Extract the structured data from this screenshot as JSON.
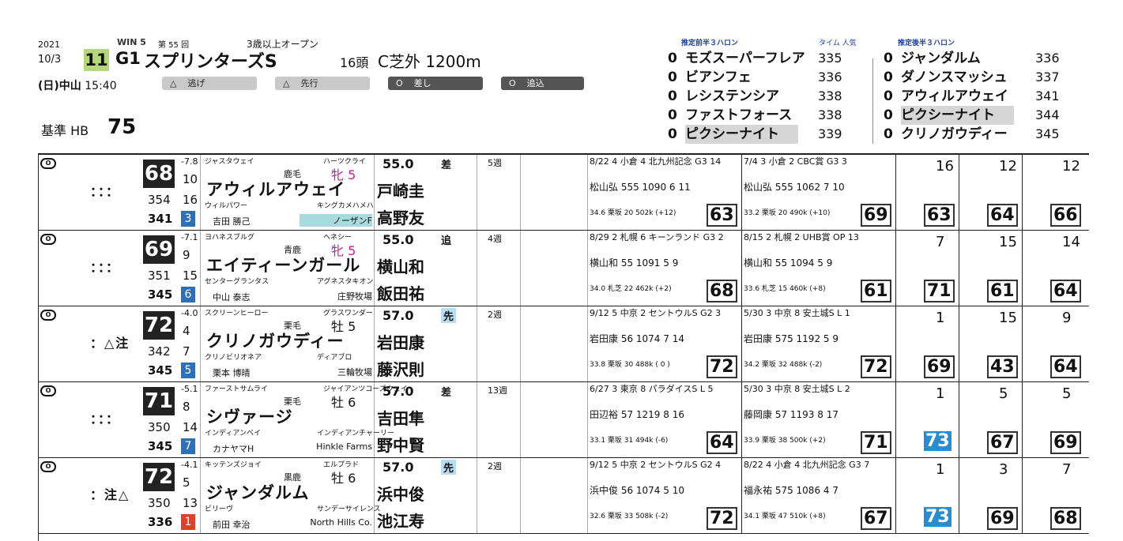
{
  "header": {
    "year": "2021",
    "date": "10/3",
    "day": "(日)",
    "venue": "中山",
    "time": "15:40",
    "win5": "WIN 5",
    "edition": "第 55 回",
    "race_no": "11",
    "grade": "G1",
    "race_name": "スプリンターズS",
    "condition": "3歳以上オープン",
    "field": "16頭",
    "course": "C芝外 1200m",
    "base_label": "基準 HB",
    "base_value": "75"
  },
  "styles": [
    {
      "mark": "△",
      "label": "逃げ"
    },
    {
      "mark": "△",
      "label": "先行"
    },
    {
      "mark": "O",
      "label": "差し"
    },
    {
      "mark": "O",
      "label": "追込"
    }
  ],
  "front_title": "推定前半３ハロン",
  "front_cols": "タイム 人気",
  "rear_title": "推定後半３ハロン",
  "front": [
    {
      "n": "0",
      "name": "モズスーパーフレア",
      "v": "335"
    },
    {
      "n": "0",
      "name": "ビアンフェ",
      "v": "336"
    },
    {
      "n": "0",
      "name": "レシステンシア",
      "v": "338"
    },
    {
      "n": "0",
      "name": "ファストフォース",
      "v": "338"
    },
    {
      "n": "0",
      "name": "ピクシーナイト",
      "v": "339"
    }
  ],
  "rear": [
    {
      "n": "0",
      "name": "ジャンダルム",
      "v": "336"
    },
    {
      "n": "0",
      "name": "ダノンスマッシュ",
      "v": "337"
    },
    {
      "n": "0",
      "name": "アウィルアウェイ",
      "v": "341"
    },
    {
      "n": "0",
      "name": "ピクシーナイト",
      "v": "344"
    },
    {
      "n": "0",
      "name": "クリノガウディー",
      "v": "345"
    }
  ],
  "horses": [
    {
      "mark": "O",
      "pred": "：：：",
      "idx": "68",
      "i1": "-7.8",
      "i2": "10",
      "i3": "354",
      "i4": "16",
      "i5": "341",
      "i6": "3",
      "sire": "ジャスタウェイ",
      "damsire": "ハーツクライ",
      "color": "鹿毛",
      "sex": "牝 5",
      "name": "アウィルアウェイ",
      "dam": "ウィルパワー",
      "damdam": "キングカメハメハ",
      "trainer": "吉田 勝己",
      "farm": "ノーザンF",
      "weight": "55.0",
      "style": "差",
      "wk": "5週",
      "jockey1": "戸崎圭",
      "jockey2": "高野友",
      "r1": "8/22 4 小倉 4 北九州記念 G3 14",
      "r1b": "松山弘 555 1090 6 11",
      "r1c": "34.6 栗坂 20 502k (+12)",
      "r1s": "63",
      "r2": "7/4 3 小倉 2 CBC賞 G3 3",
      "r2b": "松山弘 555 1062 7 10",
      "r2c": "33.2 栗坂 20 490k (+10)",
      "r2s": "69",
      "h1": "16",
      "h1s": "63",
      "h2": "12",
      "h2s": "64",
      "h3": "12",
      "h3s": "66"
    },
    {
      "mark": "O",
      "pred": "：：：",
      "idx": "69",
      "i1": "-7.1",
      "i2": "9",
      "i3": "351",
      "i4": "15",
      "i5": "345",
      "i6": "6",
      "sire": "ヨハネスブルグ",
      "damsire": "ヘネシー",
      "color": "青鹿",
      "sex": "牝 5",
      "name": "エイティーンガール",
      "dam": "センターグランタス",
      "damdam": "アグネスタキオン",
      "trainer": "中山 泰志",
      "farm": "庄野牧場",
      "weight": "55.0",
      "style": "追",
      "wk": "4週",
      "jockey1": "横山和",
      "jockey2": "飯田祐",
      "r1": "8/29 2 札幌 6 キーンランド G3 2",
      "r1b": "横山和 55 1091 5 9",
      "r1c": "34.0 札芝 22 462k (+2)",
      "r1s": "68",
      "r2": "8/15 2 札幌 2 UHB賞 OP 13",
      "r2b": "横山和 55 1094 5 9",
      "r2c": "33.6 札芝 15 460k (+8)",
      "r2s": "61",
      "h1": "7",
      "h1s": "71",
      "h2": "15",
      "h2s": "61",
      "h3": "14",
      "h3s": "64"
    },
    {
      "mark": "O",
      "pred": "：△注",
      "idx": "72",
      "i1": "-4.0",
      "i2": "4",
      "i3": "342",
      "i4": "7",
      "i5": "345",
      "i6": "5",
      "sire": "スクリーンヒーロー",
      "damsire": "グラスワンダー",
      "color": "栗毛",
      "sex": "牡 5",
      "name": "クリノガウディー",
      "dam": "クリノビリオネア",
      "damdam": "ディアブロ",
      "trainer": "栗本 博晴",
      "farm": "三輪牧場",
      "weight": "57.0",
      "style": "先",
      "wk": "2週",
      "jockey1": "岩田康",
      "jockey2": "藤沢則",
      "r1": "9/12 5 中京 2 セントウルS G2 3",
      "r1b": "岩田康 56 1074 7 14",
      "r1c": "33.8 栗坂 30 488k ( 0 )",
      "r1s": "72",
      "r2": "5/30 3 中京 8 安土城S L 1",
      "r2b": "岩田康 575 1192 5 9",
      "r2c": "34.2 栗坂 32 488k (-2)",
      "r2s": "72",
      "h1": "1",
      "h1s": "69",
      "h2": "15",
      "h2s": "43",
      "h3": "9",
      "h3s": "64"
    },
    {
      "mark": "O",
      "pred": "：：：",
      "idx": "71",
      "i1": "-5.1",
      "i2": "8",
      "i3": "350",
      "i4": "14",
      "i5": "345",
      "i6": "7",
      "sire": "ファーストサムライ",
      "damsire": "ジャイアンツコーズウェイ",
      "color": "栗毛",
      "sex": "牡 6",
      "name": "シヴァージ",
      "dam": "インディアンベイ",
      "damdam": "インディアンチャーリー",
      "trainer": "カナヤマH",
      "farm": "Hinkle Farms",
      "weight": "57.0",
      "style": "差",
      "wk": "13週",
      "jockey1": "吉田隼",
      "jockey2": "野中賢",
      "r1": "6/27 3 東京 8 パラダイスS L 5",
      "r1b": "田辺裕 57 1219 8 16",
      "r1c": "33.1 栗坂 31 494k (-6)",
      "r1s": "64",
      "r2": "5/30 3 中京 8 安土城S L 2",
      "r2b": "藤岡康 57 1193 8 17",
      "r2c": "33.9 栗坂 38 500k (+2)",
      "r2s": "71",
      "h1": "1",
      "h1s": "73",
      "h2": "5",
      "h2s": "67",
      "h3": "5",
      "h3s": "69"
    },
    {
      "mark": "O",
      "pred": "：注△",
      "idx": "72",
      "i1": "-4.1",
      "i2": "5",
      "i3": "350",
      "i4": "13",
      "i5": "336",
      "i6": "1",
      "sire": "キッテンズジョイ",
      "damsire": "エルプラド",
      "color": "黒鹿",
      "sex": "牡 6",
      "name": "ジャンダルム",
      "dam": "ビリーヴ",
      "damdam": "サンデーサイレンス",
      "trainer": "前田 幸治",
      "farm": "North Hills Co.",
      "weight": "57.0",
      "style": "先",
      "wk": "2週",
      "jockey1": "浜中俊",
      "jockey2": "池江寿",
      "r1": "9/12 5 中京 2 セントウルS G2 4",
      "r1b": "浜中俊 56 1074 5 10",
      "r1c": "32.6 栗坂 33 508k (-2)",
      "r1s": "72",
      "r2": "8/22 4 小倉 4 北九州記念 G3 7",
      "r2b": "福永祐 575 1086 4 7",
      "r2c": "34.1 栗坂 47 510k (+8)",
      "r2s": "67",
      "h1": "1",
      "h1s": "73",
      "h2": "3",
      "h2s": "69",
      "h3": "7",
      "h3s": "68"
    }
  ]
}
